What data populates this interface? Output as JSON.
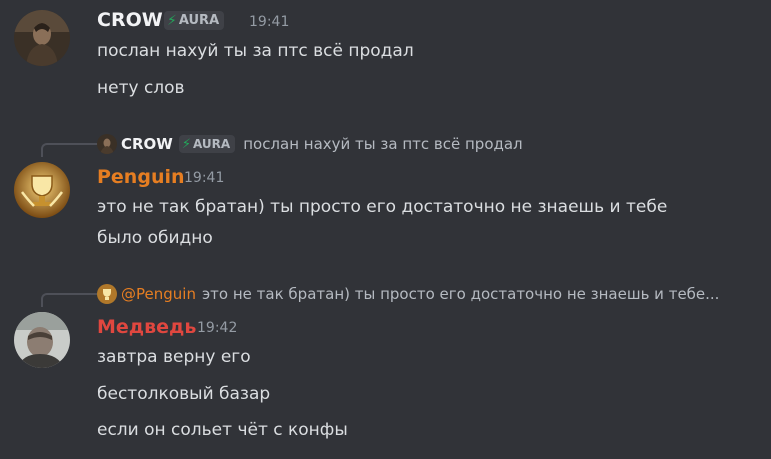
{
  "colors": {
    "background": "#313338",
    "crow_name": "#f2f3f5",
    "penguin_name": "#e67e22",
    "medved_name": "#e0473f",
    "tag_bolt": "#23a55a"
  },
  "messages": [
    {
      "author": "CROW",
      "tag": "AURA",
      "tag_icon": "bolt-icon",
      "time": "19:41",
      "lines": [
        "послан нахуй ты за птс всё продал",
        "нету слов"
      ]
    },
    {
      "reply": {
        "author": "CROW",
        "tag": "AURA",
        "text": "послан нахуй ты за птс всё продал"
      },
      "author": "Penguin",
      "time": "19:41",
      "lines": [
        "это не так братан) ты просто его достаточно не знаешь и тебе",
        "было обидно"
      ]
    },
    {
      "reply": {
        "author": "@Penguin",
        "text": "это не так братан) ты просто его достаточно не знаешь и тебе..."
      },
      "author": "Медведь",
      "time": "19:42",
      "lines": [
        "завтра верну его",
        "бестолковый базар",
        "если он сольет чёт с конфы"
      ]
    }
  ]
}
